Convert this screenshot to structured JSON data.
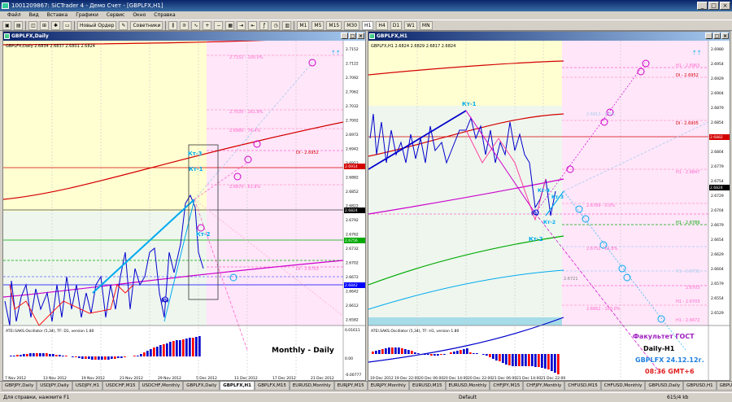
{
  "window": {
    "title": "1001209867: SiCTrader 4 - Демо Счет - [GBPLFX,H1]",
    "controls": [
      "_",
      "□",
      "×"
    ]
  },
  "menu": [
    "Файл",
    "Вид",
    "Вставка",
    "Графики",
    "Сервис",
    "Окно",
    "Справка"
  ],
  "toolbar": {
    "new_order": "Новый Ордер",
    "advisors": "Советники",
    "timeframes": [
      "M1",
      "M5",
      "M15",
      "M30",
      "H1",
      "H4",
      "D1",
      "W1",
      "MN"
    ]
  },
  "left_chart": {
    "window_title": "GBPLFX,Daily",
    "info": "GBPLFX,Daily 2.6834 2.6837 2.6801 2.6824",
    "price_labels": [
      "2.7152",
      "2.7122",
      "2.7092",
      "2.7062",
      "2.7032",
      "2.7002",
      "2.6972",
      "2.6942",
      "2.6912",
      "2.6882",
      "2.6852",
      "2.6822",
      "2.6792",
      "2.6762",
      "2.6732",
      "2.6702",
      "2.6672",
      "2.6642",
      "2.6612",
      "2.6582"
    ],
    "current_price": "2.6824",
    "markers": [
      "2.6914",
      "2.6756",
      "2.6842"
    ],
    "level_labels": {
      "l1": "2.7152 - 100.0%",
      "l2": "2.7035 - 161.8%",
      "l3": "2.6980 - 76.4%",
      "l4": "DI - 2.6952",
      "l5": "2.6870 - 61.8%",
      "l6": "DI - 2.6703"
    },
    "point_labels": {
      "kt3": "Кт-3",
      "kt1": "Кт-1",
      "kt2": "Кт-2",
      "o": "(0)"
    },
    "date_labels": [
      "7 Nov 2012",
      "13 Nov 2012",
      "19 Nov 2012",
      "23 Nov 2012",
      "29 Nov 2012",
      "5 Dec 2012",
      "11 Dec 2012",
      "17 Dec 2012",
      "21 Dec 2012"
    ],
    "oscillator": {
      "title": "ATEI.SAKS.Oscillator (5,34), TF: D1, version 1.80",
      "scale": [
        "0.01611",
        "0.00",
        "-0.00777"
      ],
      "label": "Monthly - Daily"
    }
  },
  "right_chart": {
    "window_title": "GBPLFX,H1",
    "info": "GBPLFX,H1 2.6824 2.6829 2.6817 2.6824",
    "price_labels": [
      "2.6980",
      "2.6954",
      "2.6929",
      "2.6904",
      "2.6879",
      "2.6854",
      "2.6829",
      "2.6804",
      "2.6779",
      "2.6754",
      "2.6729",
      "2.6704",
      "2.6679",
      "2.6654",
      "2.6629",
      "2.6604",
      "2.6579",
      "2.6554",
      "2.6529"
    ],
    "current_price": "2.6824",
    "marker": "2.6882",
    "level_labels": {
      "h1a": "H1 - 2.6963",
      "d1": "DI - 2.6952",
      "r1": "2.6913 - 0.0%",
      "h1b": "DI - 2.6905",
      "h1c": "H1 - 2.6847",
      "r2": "2.6789 - 0.0%",
      "h1d": "H1 - 2.6789",
      "r3": "2.6752 - 61.8%",
      "h1e": "H1 - 2.6731",
      "r4": "2.6721",
      "r5": "2.6703",
      "h1f": "H1 - 2.6703",
      "r6": "2.6662 - 100.0%",
      "h1g": "H1 - 2.6672"
    },
    "point_labels": {
      "kt1": "Кт-1",
      "kt4": "Кт-4",
      "kt3": "Кт-3",
      "kt2": "Кт-2",
      "o": "(0)"
    },
    "date_labels": [
      "19 Dec 2012",
      "19 Dec 22:00",
      "20 Dec 06:00",
      "20 Dec 14:00",
      "20 Dec 22:00",
      "21 Dec 06:00",
      "21 Dec 14:00",
      "21 Dec 22:00"
    ],
    "oscillator": {
      "title": "ATEI.SAKS.Oscillator (5,34), TF: H1, version 1.80"
    },
    "branding": {
      "faculty": "Факультет ГОСТ",
      "tf": "Daily-H1",
      "symbol_date": "GBPLFX 24.12.12г.",
      "time": "08:36 GMT+6"
    }
  },
  "tabs": [
    "GBPJPY,Daily",
    "USDJPY,Daily",
    "USDJPY,H1",
    "USDCHF,M15",
    "USDCHF,Monthly",
    "GBPLFX,Daily",
    "GBPLFX,H1",
    "GBPLFX,M15",
    "EURUSD,Monthly",
    "EURJPY,M15",
    "EURJPY,Monthly",
    "EURUSD,M15",
    "EURUSD,Monthly",
    "CHFJPY,M15",
    "CHFJPY,Monthly",
    "CHFUSD,M15",
    "CHFUSD,Monthly",
    "GBPUSD,Daily",
    "GBPUSD,H1",
    "GBPUSD,M15",
    "GBPUSD,Monthly",
    "GBPJPY,Daily"
  ],
  "active_tab": 6,
  "status": {
    "help": "Для справки, нажмите F1",
    "profile": "Default",
    "traffic": "615/4 kb"
  },
  "colors": {
    "pink_zone": "#ffe6f9",
    "yellow_zone": "#ffffd2",
    "red_ma": "#d40000",
    "magenta_ma": "#cc00cc",
    "green_ma": "#00aa00",
    "blue_bars": "#0000cc",
    "red_bars": "#ff0000",
    "cyan": "#00aaee",
    "brand_purple": "#a020c0",
    "brand_blue": "#2080e0",
    "brand_red": "#e02020"
  }
}
